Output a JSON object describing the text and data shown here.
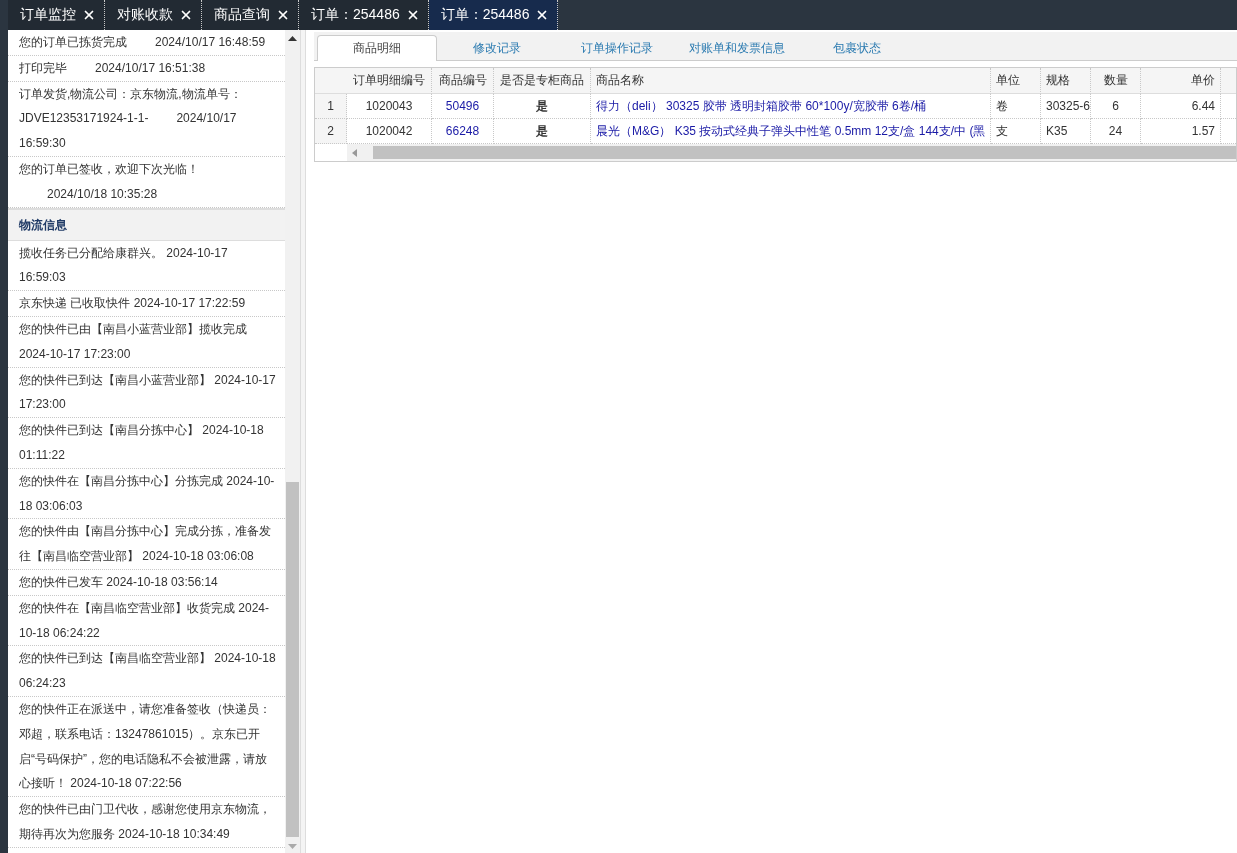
{
  "top_tabs": [
    {
      "label": "订单监控",
      "selected": false
    },
    {
      "label": "对账收款",
      "selected": false
    },
    {
      "label": "商品查询",
      "selected": false
    },
    {
      "label": "订单：254486",
      "selected": false
    },
    {
      "label": "订单：254486",
      "selected": true
    }
  ],
  "order_history": [
    {
      "text": "您的订单已拣货完成",
      "time": "2024/10/17 16:48:59"
    },
    {
      "text": "打印完毕",
      "time": "2024/10/17 16:51:38"
    },
    {
      "text": "订单发货,物流公司：京东物流,物流单号：JDVE12353171924-1-1-",
      "time": "2024/10/17 16:59:30"
    },
    {
      "text": "您的订单已签收，欢迎下次光临！",
      "time": "2024/10/18 10:35:28"
    }
  ],
  "logistics": {
    "title": "物流信息",
    "events": [
      "揽收任务已分配给康群兴。 2024-10-17 16:59:03",
      "京东快递 已收取快件 2024-10-17 17:22:59",
      "您的快件已由【南昌小蓝营业部】揽收完成 2024-10-17 17:23:00",
      "您的快件已到达【南昌小蓝营业部】 2024-10-17 17:23:00",
      "您的快件已到达【南昌分拣中心】 2024-10-18 01:11:22",
      "您的快件在【南昌分拣中心】分拣完成 2024-10-18 03:06:03",
      "您的快件由【南昌分拣中心】完成分拣，准备发往【南昌临空营业部】 2024-10-18 03:06:08",
      "您的快件已发车 2024-10-18 03:56:14",
      "您的快件在【南昌临空营业部】收货完成 2024-10-18 06:24:22",
      "您的快件已到达【南昌临空营业部】 2024-10-18 06:24:23",
      "您的快件正在派送中，请您准备签收（快递员：邓超，联系电话：13247861015）。京东已开启“号码保护”，您的电话隐私不会被泄露，请放心接听！ 2024-10-18 07:22:56",
      "您的快件已由门卫代收，感谢您使用京东物流，期待再次为您服务 2024-10-18 10:34:49"
    ]
  },
  "detail_tabs": [
    {
      "label": "商品明细",
      "selected": true
    },
    {
      "label": "修改记录",
      "selected": false
    },
    {
      "label": "订单操作记录",
      "selected": false
    },
    {
      "label": "对账单和发票信息",
      "selected": false
    },
    {
      "label": "包裹状态",
      "selected": false
    }
  ],
  "table": {
    "columns": [
      "订单明细编号",
      "商品编号",
      "是否是专柜商品",
      "商品名称",
      "单位",
      "规格",
      "数量",
      "单价"
    ],
    "rows": [
      {
        "index": "1",
        "cells": [
          "1020043",
          "50496",
          "是",
          "得力（deli） 30325 胶带 透明封箱胶带 60*100y/宽胶带 6卷/桶",
          "卷",
          "30325-6",
          "6",
          "6.44"
        ]
      },
      {
        "index": "2",
        "cells": [
          "1020042",
          "66248",
          "是",
          "晨光（M&G） K35 按动式经典子弹头中性笔 0.5mm 12支/盒 144支/中 (黑",
          "支",
          "K35",
          "24",
          "1.57"
        ]
      }
    ]
  }
}
